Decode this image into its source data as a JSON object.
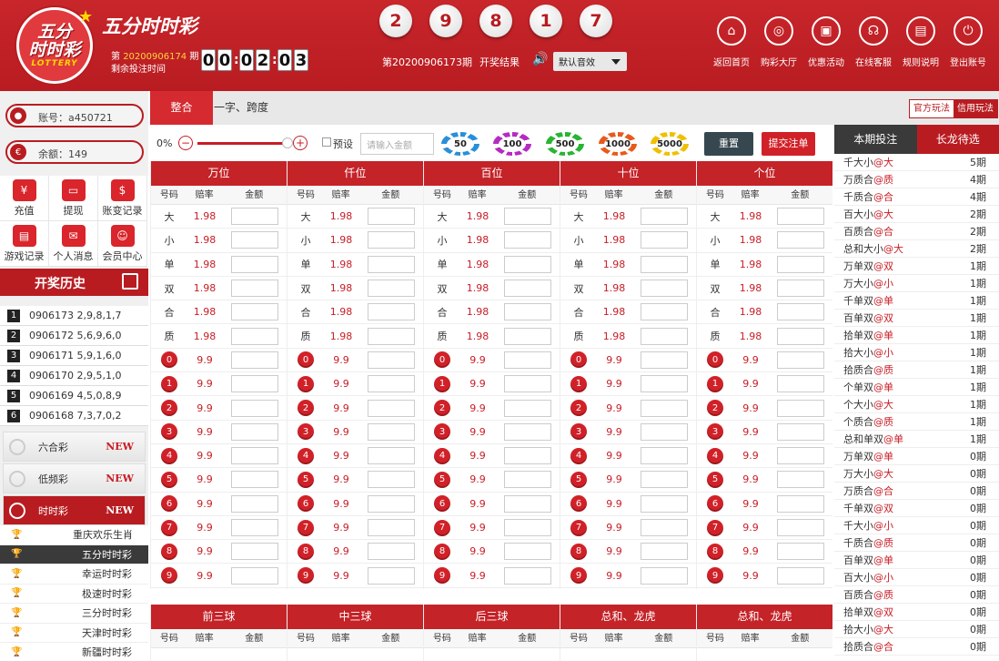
{
  "header": {
    "logo_text_1": "五分",
    "logo_text_2": "时时彩",
    "logo_lottery": "LOTTERY",
    "title": "五分时时彩",
    "issue_prefix": "第",
    "issue_number": "20200906174",
    "issue_suffix": "期",
    "remaining_label": "剩余投注时间",
    "timer_digits": [
      "0",
      "0",
      "0",
      "2",
      "0",
      "3"
    ],
    "draw_balls": [
      "2",
      "9",
      "8",
      "1",
      "7"
    ],
    "draw_issue_label": "第20200906173期",
    "result_label": "开奖结果",
    "sound_selected": "默认音效",
    "nav": [
      {
        "label": "返回首页",
        "icon": "home-icon"
      },
      {
        "label": "购彩大厅",
        "icon": "lottery-hall-icon"
      },
      {
        "label": "优惠活动",
        "icon": "promotion-icon"
      },
      {
        "label": "在线客服",
        "icon": "headset-icon"
      },
      {
        "label": "规则说明",
        "icon": "rules-icon"
      },
      {
        "label": "登出账号",
        "icon": "power-icon"
      }
    ]
  },
  "account": {
    "label": "账号：a450721",
    "balance": "余额：149"
  },
  "quick": [
    {
      "label": "充值",
      "icon": "yen-icon"
    },
    {
      "label": "提现",
      "icon": "wallet-icon"
    },
    {
      "label": "账变记录",
      "icon": "ledger-icon"
    },
    {
      "label": "游戏记录",
      "icon": "record-icon"
    },
    {
      "label": "个人消息",
      "icon": "message-icon"
    },
    {
      "label": "会员中心",
      "icon": "member-icon"
    }
  ],
  "history": {
    "title": "开奖历史",
    "rows": [
      {
        "idx": "1",
        "text": "0906173  2,9,8,1,7"
      },
      {
        "idx": "2",
        "text": "0906172  5,6,9,6,0"
      },
      {
        "idx": "3",
        "text": "0906171  5,9,1,6,0"
      },
      {
        "idx": "4",
        "text": "0906170  2,9,5,1,0"
      },
      {
        "idx": "5",
        "text": "0906169  4,5,0,8,9"
      },
      {
        "idx": "6",
        "text": "0906168  7,3,7,0,2"
      }
    ]
  },
  "games": [
    {
      "label": "六合彩",
      "badge": "NEW"
    },
    {
      "label": "低频彩",
      "badge": "NEW"
    },
    {
      "label": "时时彩",
      "badge": "NEW"
    }
  ],
  "subgames": [
    "重庆欢乐生肖",
    "五分时时彩",
    "幸运时时彩",
    "极速时时彩",
    "三分时时彩",
    "天津时时彩",
    "新疆时时彩"
  ],
  "tabs": [
    "整合",
    "一字、跨度"
  ],
  "play_modes": [
    "官方玩法",
    "信用玩法"
  ],
  "controls": {
    "percent": "0%",
    "preset": "预设",
    "amount_placeholder": "请输入金额",
    "chips": [
      "50",
      "100",
      "500",
      "1000",
      "5000"
    ],
    "reset": "重置",
    "submit": "提交注单"
  },
  "board": {
    "positions": [
      "万位",
      "仟位",
      "百位",
      "十位",
      "个位"
    ],
    "col_headers": [
      "号码",
      "赔率",
      "金额"
    ],
    "text_rows": [
      {
        "label": "大",
        "odds": "1.98"
      },
      {
        "label": "小",
        "odds": "1.98"
      },
      {
        "label": "单",
        "odds": "1.98"
      },
      {
        "label": "双",
        "odds": "1.98"
      },
      {
        "label": "合",
        "odds": "1.98"
      },
      {
        "label": "质",
        "odds": "1.98"
      }
    ],
    "digit_odds": "9.9",
    "digits": [
      "0",
      "1",
      "2",
      "3",
      "4",
      "5",
      "6",
      "7",
      "8",
      "9"
    ]
  },
  "board2": {
    "sections": [
      "前三球",
      "中三球",
      "后三球",
      "总和、龙虎",
      "总和、龙虎"
    ],
    "col_headers": [
      "号码",
      "赔率",
      "金额"
    ]
  },
  "right": {
    "tabs": [
      "本期投注",
      "长龙待选"
    ],
    "rows": [
      {
        "name": "千大小",
        "tag": "@大",
        "count": "5期"
      },
      {
        "name": "万质合",
        "tag": "@质",
        "count": "4期"
      },
      {
        "name": "千质合",
        "tag": "@合",
        "count": "4期"
      },
      {
        "name": "百大小",
        "tag": "@大",
        "count": "2期"
      },
      {
        "name": "百质合",
        "tag": "@合",
        "count": "2期"
      },
      {
        "name": "总和大小",
        "tag": "@大",
        "count": "2期"
      },
      {
        "name": "万单双",
        "tag": "@双",
        "count": "1期"
      },
      {
        "name": "万大小",
        "tag": "@小",
        "count": "1期"
      },
      {
        "name": "千单双",
        "tag": "@单",
        "count": "1期"
      },
      {
        "name": "百单双",
        "tag": "@双",
        "count": "1期"
      },
      {
        "name": "拾单双",
        "tag": "@单",
        "count": "1期"
      },
      {
        "name": "拾大小",
        "tag": "@小",
        "count": "1期"
      },
      {
        "name": "拾质合",
        "tag": "@质",
        "count": "1期"
      },
      {
        "name": "个单双",
        "tag": "@单",
        "count": "1期"
      },
      {
        "name": "个大小",
        "tag": "@大",
        "count": "1期"
      },
      {
        "name": "个质合",
        "tag": "@质",
        "count": "1期"
      },
      {
        "name": "总和单双",
        "tag": "@单",
        "count": "1期"
      },
      {
        "name": "万单双",
        "tag": "@单",
        "count": "0期"
      },
      {
        "name": "万大小",
        "tag": "@大",
        "count": "0期"
      },
      {
        "name": "万质合",
        "tag": "@合",
        "count": "0期"
      },
      {
        "name": "千单双",
        "tag": "@双",
        "count": "0期"
      },
      {
        "name": "千大小",
        "tag": "@小",
        "count": "0期"
      },
      {
        "name": "千质合",
        "tag": "@质",
        "count": "0期"
      },
      {
        "name": "百单双",
        "tag": "@单",
        "count": "0期"
      },
      {
        "name": "百大小",
        "tag": "@小",
        "count": "0期"
      },
      {
        "name": "百质合",
        "tag": "@质",
        "count": "0期"
      },
      {
        "name": "拾单双",
        "tag": "@双",
        "count": "0期"
      },
      {
        "name": "拾大小",
        "tag": "@大",
        "count": "0期"
      },
      {
        "name": "拾质合",
        "tag": "@合",
        "count": "0期"
      }
    ]
  },
  "colors": {
    "brand_red": "#b81c21",
    "odds_red": "#c81d25",
    "dark": "#3a3a3a"
  }
}
